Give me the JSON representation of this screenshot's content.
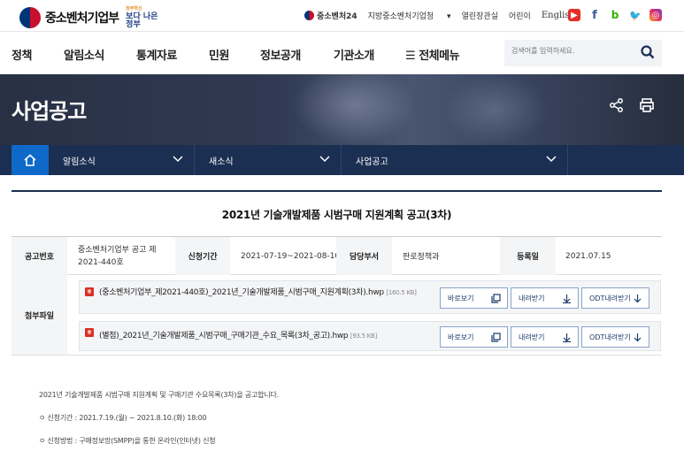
{
  "header": {
    "logo_text": "중소벤처기업부",
    "slogan_small": "정부혁신",
    "slogan": "보다 나은 정부",
    "links": [
      "중소벤처24",
      "지방중소벤처기업청",
      "열린장관실",
      "어린이",
      "English"
    ],
    "sns_icons": [
      "youtube-icon",
      "facebook-icon",
      "blog-icon",
      "twitter-icon",
      "instagram-icon"
    ]
  },
  "gnb": {
    "menus": [
      "정책",
      "알림소식",
      "통계자료",
      "민원",
      "정보공개",
      "기관소개",
      "전체메뉴"
    ],
    "search_placeholder": "검색어를 입력하세요."
  },
  "banner": {
    "title": "사업공고"
  },
  "location": {
    "items": [
      "알림소식",
      "새소식",
      "사업공고"
    ]
  },
  "post": {
    "title": "2021년 기술개발제품 시범구매 지원계획 공고(3차)",
    "labels": {
      "no": "공고번호",
      "period": "신청기간",
      "dept": "담당부서",
      "date": "등록일",
      "files": "첨부파일"
    },
    "no": "중소벤처기업부 공고 제2021-440호",
    "period": "2021-07-19~2021-08-10",
    "dept": "판로정책과",
    "date": "2021.07.15",
    "files": [
      {
        "name": "(중소벤처기업부_제2021-440호)_2021년_기술개발제품_시범구매_지원계획(3차).hwp",
        "size": "[160.5 KB]"
      },
      {
        "name": "(별첨)_2021년_기술개발제품_시범구매_구매기관_수요_목록(3차_공고).hwp",
        "size": "[93.5 KB]"
      }
    ],
    "buttons": {
      "view": "바로보기",
      "download": "내려받기",
      "odt": "ODT내려받기"
    },
    "body": [
      "2021년 기술개발제품 시범구매 지원계획 및 구매기관 수요목록(3차)을 공고합니다.",
      "ㅇ 신청기간 : 2021.7.19.(월) ~ 2021.8.10.(화) 18:00",
      "ㅇ 신청방법 : 구매정보망(SMPP)을 통한 온라인(인터넷) 신청"
    ]
  },
  "colors": {
    "navy": "#1b2f52",
    "blue": "#0e69c9",
    "accent_red": "#c8102e"
  }
}
